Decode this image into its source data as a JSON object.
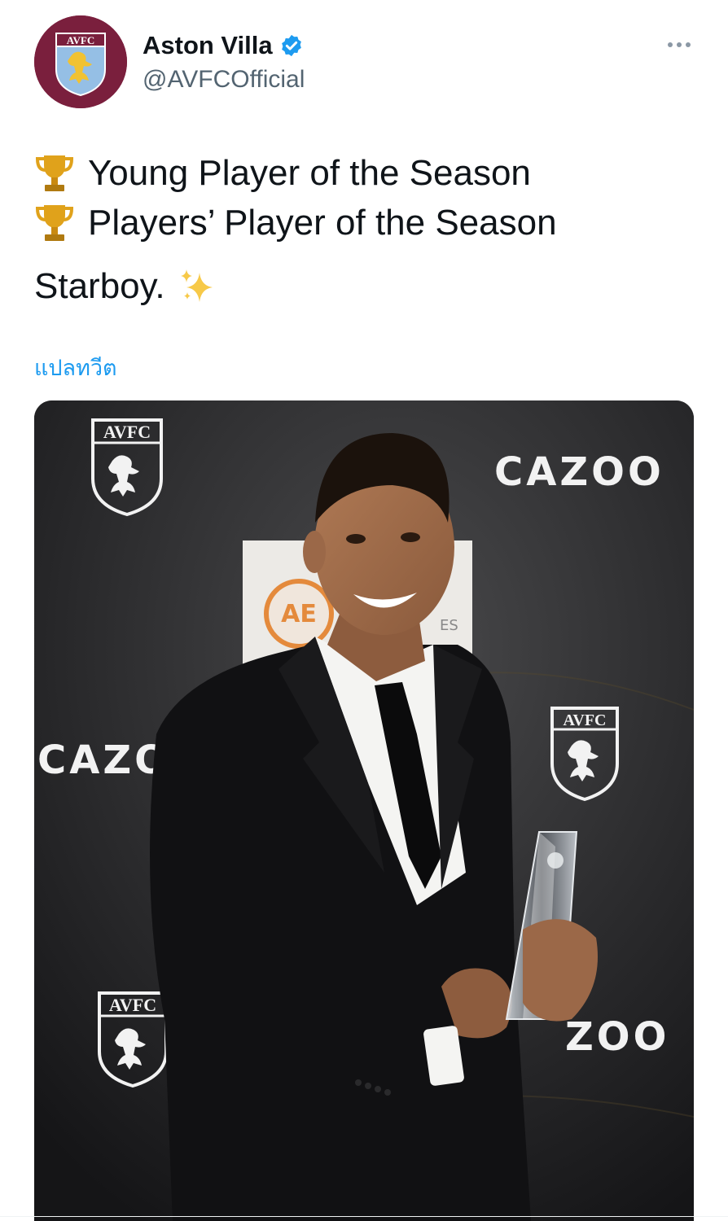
{
  "tweet": {
    "author": {
      "display_name": "Aston Villa",
      "handle": "@AVFCOfficial",
      "verified": true,
      "avatar_text": "AVFC",
      "avatar_color": "#7a1f3d"
    },
    "lines": [
      {
        "icon": "trophy-icon",
        "text": "Young Player of the Season"
      },
      {
        "icon": "trophy-icon",
        "text": "Players’ Player of the Season"
      }
    ],
    "closing_text": "Starboy.",
    "closing_icon": "sparkles-icon",
    "translate_label": "แปลทวีต"
  },
  "media": {
    "backdrop": {
      "crest_text": "AVFC",
      "sponsor_text": "CAZOO",
      "sponsor_partial_left": "CAZO",
      "sponsor_partial_right": "ZOO",
      "board_text": "AE",
      "board_side_text": "ES"
    }
  },
  "colors": {
    "link": "#1d9bf0",
    "verified": "#1d9bf0",
    "secondary_text": "#536471",
    "club_claret": "#7a1f3d",
    "club_blue": "#95bfe5"
  }
}
